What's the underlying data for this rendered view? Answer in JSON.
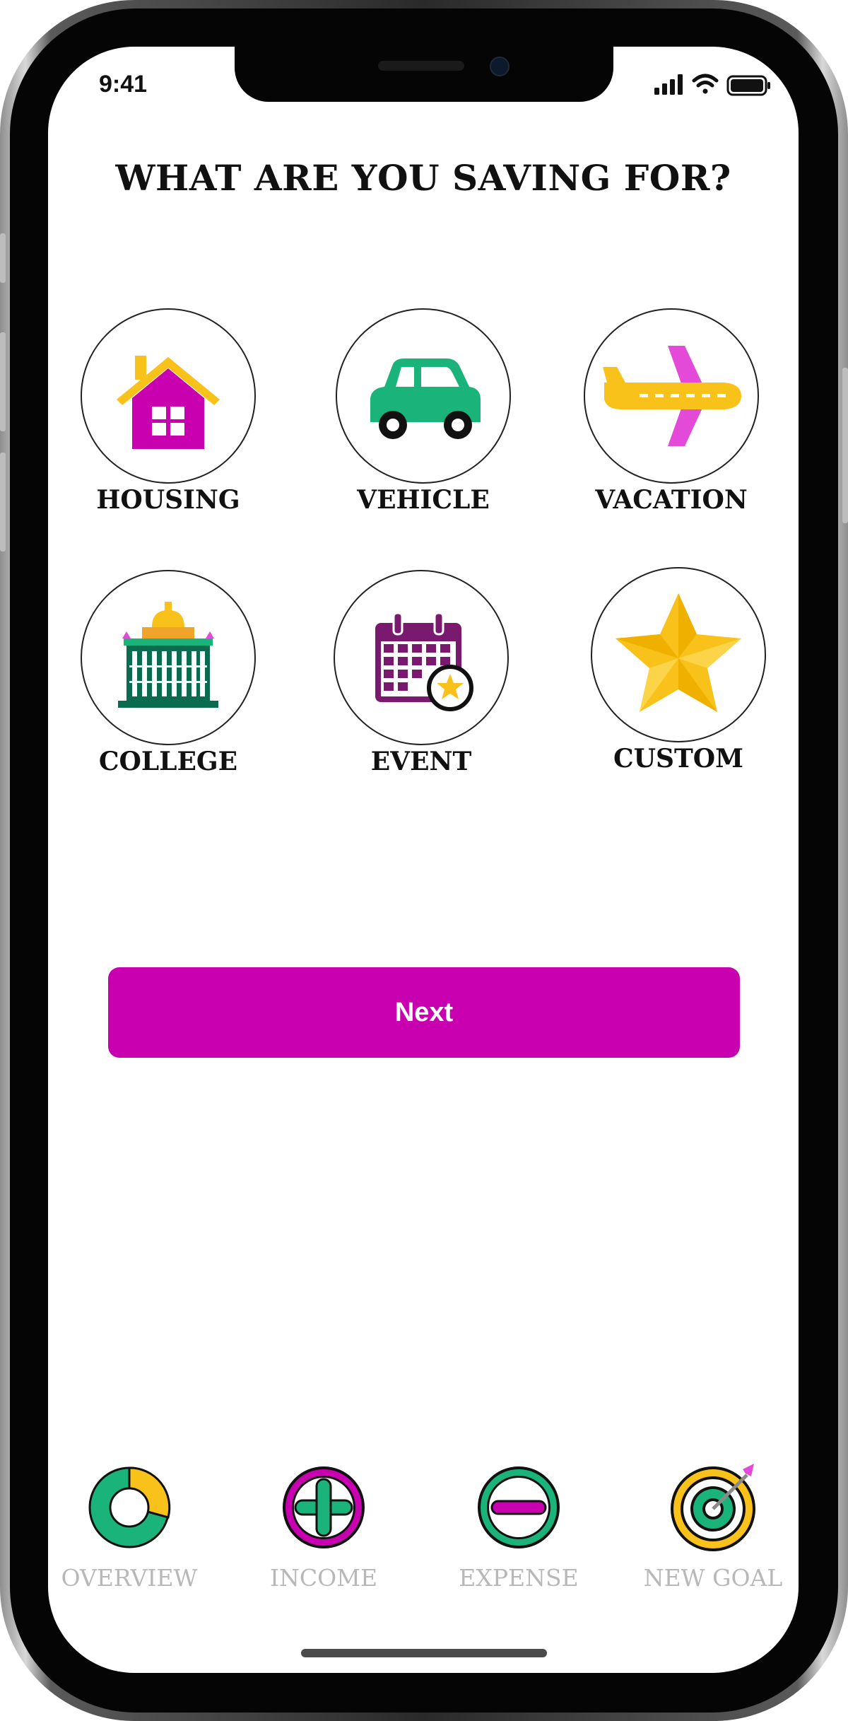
{
  "status_bar": {
    "time": "9:41"
  },
  "page": {
    "title": "WHAT ARE YOU SAVING FOR?"
  },
  "options": [
    {
      "label": "HOUSING",
      "icon": "house-icon"
    },
    {
      "label": "VEHICLE",
      "icon": "car-icon"
    },
    {
      "label": "VACATION",
      "icon": "airplane-icon"
    },
    {
      "label": "COLLEGE",
      "icon": "college-building-icon"
    },
    {
      "label": "EVENT",
      "icon": "calendar-star-icon"
    },
    {
      "label": "CUSTOM",
      "icon": "star-icon"
    }
  ],
  "next_button": {
    "label": "Next"
  },
  "tab_bar": {
    "tabs": [
      {
        "label": "OVERVIEW",
        "icon": "donut-chart-icon"
      },
      {
        "label": "INCOME",
        "icon": "plus-circle-icon"
      },
      {
        "label": "EXPENSE",
        "icon": "minus-circle-icon"
      },
      {
        "label": "NEW GOAL",
        "icon": "target-icon"
      }
    ]
  },
  "colors": {
    "magenta": "#c800b0",
    "green": "#1ab47a",
    "yellow": "#f8c21a",
    "dark_green": "#0b6b4f",
    "purple": "#7a1a6e",
    "inactive_tab_text": "#b8b8b8"
  }
}
